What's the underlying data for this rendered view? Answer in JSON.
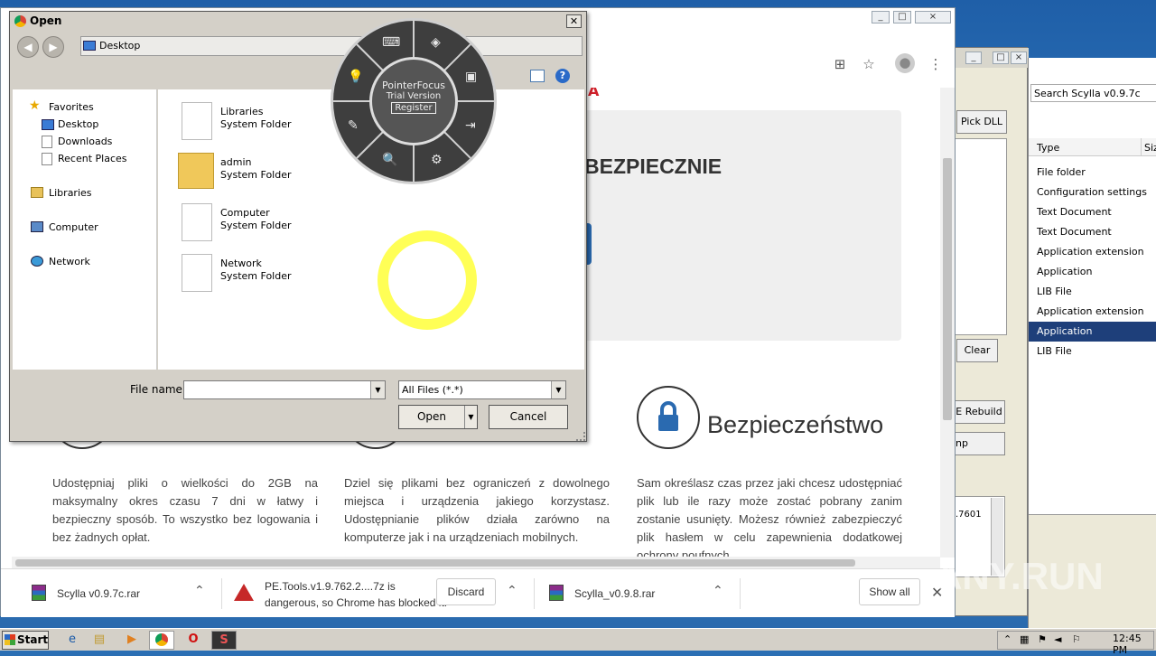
{
  "dialog": {
    "title": "Open",
    "address": "Desktop",
    "nav": {
      "favorites": "Favorites",
      "favorites_items": [
        "Desktop",
        "Downloads",
        "Recent Places"
      ],
      "libraries": "Libraries",
      "computer": "Computer",
      "network": "Network"
    },
    "files": [
      {
        "name": "Libraries",
        "type": "System Folder"
      },
      {
        "name": "admin",
        "type": "System Folder"
      },
      {
        "name": "Computer",
        "type": "System Folder"
      },
      {
        "name": "Network",
        "type": "System Folder"
      }
    ],
    "file_name_label": "File name:",
    "file_name_value": "",
    "file_type": "All Files (*.*)",
    "open_label": "Open",
    "cancel_label": "Cancel"
  },
  "pointerfocus": {
    "name": "PointerFocus",
    "edition": "Trial Version",
    "register": "Register"
  },
  "webpage": {
    "headline_fragment": "BEZPIECZNIE",
    "feature_title": "Bezpieczeństwo",
    "col1": "Udostępniaj pliki o wielkości do 2GB na maksymalny okres czasu 7 dni w łatwy i bezpieczny sposób. To wszystko bez logowania i bez żadnych opłat.",
    "col2": "Dziel się plikami bez ograniczeń z dowolnego miejsca i urządzenia jakiego korzystasz. Udostępnianie plików działa zarówno na komputerze jak i na urządzeniach mobilnych.",
    "col3": "Sam określasz czas przez jaki chcesz udostępniać plik lub ile razy może zostać pobrany zanim zostanie usunięty. Możesz również zabezpieczyć plik hasłem w celu zapewnienia dodatkowej ochrony poufnych"
  },
  "downloads": {
    "item1": "Scylla v0.9.7c.rar",
    "item2_line1": "PE.Tools.v1.9.762.2....7z is",
    "item2_line2": "dangerous, so Chrome has blocked it.",
    "discard": "Discard",
    "item3": "Scylla_v0.9.8.rar",
    "show_all": "Show all"
  },
  "scylla": {
    "pick_dll": "Pick DLL",
    "clear": "Clear",
    "rebuild": "E Rebuild",
    "mp": "np",
    "value": ".7601"
  },
  "explorer": {
    "search": "Search Scylla v0.9.7c",
    "col_type": "Type",
    "col_size": "Siz",
    "rows": [
      "File folder",
      "Configuration settings",
      "Text Document",
      "Text Document",
      "Application extension",
      "Application",
      "LIB File",
      "Application extension",
      "Application",
      "LIB File"
    ],
    "selected_index": 8
  },
  "taskbar": {
    "start": "Start",
    "clock": "12:45 PM"
  },
  "watermark": "ANY.RUN"
}
